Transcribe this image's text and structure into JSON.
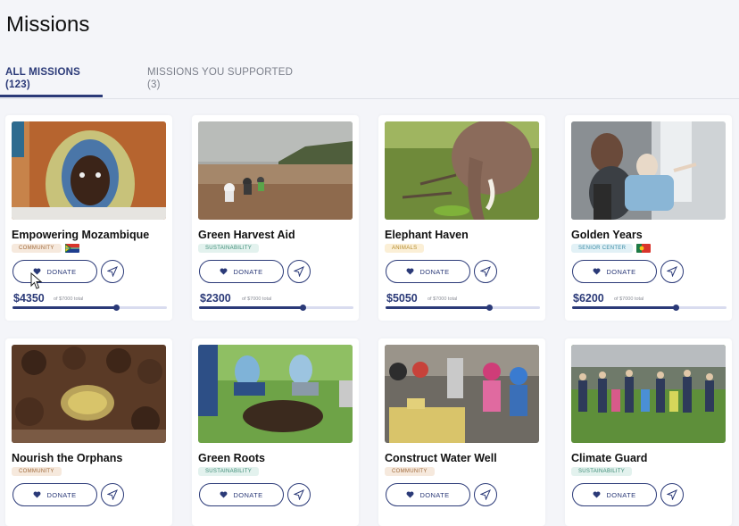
{
  "page": {
    "title": "Missions"
  },
  "tabs": {
    "all_line1": "ALL MISSIONS",
    "all_line2": "(123)",
    "supported_line1": "MISSIONS YOU SUPPORTED",
    "supported_line2": "(3)"
  },
  "labels": {
    "donate": "DONATE"
  },
  "colors": {
    "accent": "#2b3a78",
    "progress_track": "#d9dcef",
    "background": "#f4f5f9"
  },
  "missions": [
    {
      "name": "Empowering Mozambique",
      "tag": "COMMUNITY",
      "flag": "south-africa-flag",
      "amount": "$4350",
      "total": "of $7000 total",
      "progress": 0.67
    },
    {
      "name": "Green Harvest Aid",
      "tag": "SUSTAINABILITY",
      "amount": "$2300",
      "total": "of $7000 total",
      "progress": 0.67
    },
    {
      "name": "Elephant Haven",
      "tag": "ANIMALS",
      "amount": "$5050",
      "total": "of $7000 total",
      "progress": 0.67
    },
    {
      "name": "Golden Years",
      "tag": "SENIOR CENTER",
      "flag": "portugal-flag",
      "amount": "$6200",
      "total": "of $7000 total",
      "progress": 0.67
    },
    {
      "name": "Nourish the Orphans",
      "tag": "COMMUNITY"
    },
    {
      "name": "Green Roots",
      "tag": "SUSTAINABILITY"
    },
    {
      "name": "Construct Water Well",
      "tag": "COMMUNITY"
    },
    {
      "name": "Climate Guard",
      "tag": "SUSTAINABILITY"
    }
  ]
}
